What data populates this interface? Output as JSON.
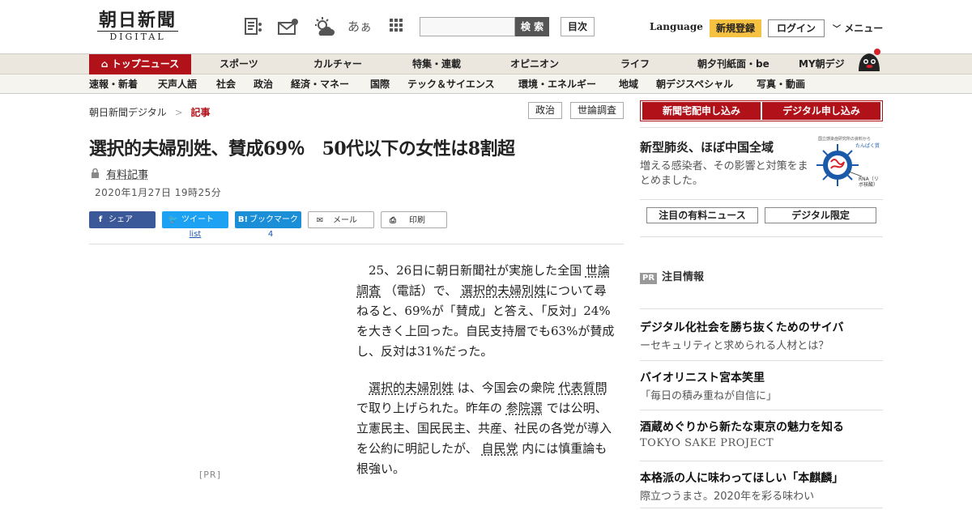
{
  "header": {
    "logo_main": "朝日新聞",
    "logo_sub": "DIGITAL",
    "search_label": "検 索",
    "index_label": "目次",
    "language_label": "Language",
    "register_label": "新規登録",
    "login_label": "ログイン",
    "menu_label": "メニュー",
    "font_toggle_label": "あぁ"
  },
  "nav_main": [
    "トップニュース",
    "スポーツ",
    "カルチャー",
    "特集・連載",
    "オピニオン",
    "ライフ",
    "朝夕刊紙面・be",
    "MY朝デジ"
  ],
  "nav_sub": [
    "速報・新着",
    "天声人語",
    "社会",
    "政治",
    "経済・マネー",
    "国際",
    "テック＆サイエンス",
    "環境・エネルギー",
    "地域",
    "朝デジスペシャル",
    "写真・動画"
  ],
  "breadcrumb": {
    "home": "朝日新聞デジタル",
    "sep": ">",
    "current": "記事"
  },
  "tags": [
    "政治",
    "世論調査"
  ],
  "article": {
    "headline": "選択的夫婦別姓、賛成69％　50代以下の女性は8割超",
    "paid_label": "有料記事",
    "date": "2020年1月27日 19時25分",
    "share": {
      "facebook": "シェア",
      "twitter": "ツイート",
      "hatena": "ブックマーク",
      "mail": "メール",
      "print": "印刷",
      "twitter_count": "list",
      "hatena_count": "4"
    },
    "pr_label": "[PR]",
    "p1": {
      "t1": "25、26日に朝日新聞社が実施した全国",
      "l1": "世論調査",
      "t2": "（電話）で、",
      "l2": "選択的夫婦別姓",
      "t3": "について尋ねると、69%が「賛成」と答え、「反対」24%を大きく上回った。自民支持層でも63%が賛成し、反対は31%だった。"
    },
    "p2": {
      "l1": "選択的夫婦別姓",
      "t1": "は、今国会の衆院",
      "l2": "代表質問",
      "t2": "で取り上げられた。昨年の",
      "l3": "参院選",
      "t3": "では公明、立憲民主、国民民主、共産、社民の各党が導入を公約に明記したが、",
      "l4": "自民党",
      "t4": "内には慎重論も根強い。"
    }
  },
  "sidebar": {
    "newspaper_btn": "新聞宅配申し込み",
    "digital_btn": "デジタル申し込み",
    "covid_title": "新型肺炎、ほぼ中国全域",
    "covid_desc": "増える感染者、その影響と対策をまとめました。",
    "virus_caption_top": "国立感染症研究所の資料から",
    "virus_caption_brand": "たんぱく質",
    "virus_caption_rna": "RNA（リボ核酸）",
    "btn_featured": "注目の有料ニュース",
    "btn_limited": "デジタル限定",
    "pr_badge": "PR",
    "pr_heading": "注目情報",
    "ads": [
      {
        "title": "デジタル化社会を勝ち抜くためのサイバ",
        "sub": "ーセキュリティと求められる人材とは？"
      },
      {
        "title": "バイオリニスト宮本笑里",
        "sub": "「毎日の積み重ねが自信に」"
      },
      {
        "title": "酒蔵めぐりから新たな東京の魅力を知る",
        "sub": "TOKYO SAKE PROJECT"
      },
      {
        "title": "本格派の人に味わってほしい「本麒麟」",
        "sub": "際立つうまさ。2020年を彩る味わい"
      }
    ]
  },
  "colors": {
    "brand_red": "#b1121a",
    "register_yellow": "#f5c140",
    "facebook": "#3b5998",
    "twitter": "#1da1f2",
    "hatena": "#1a8fd8"
  }
}
